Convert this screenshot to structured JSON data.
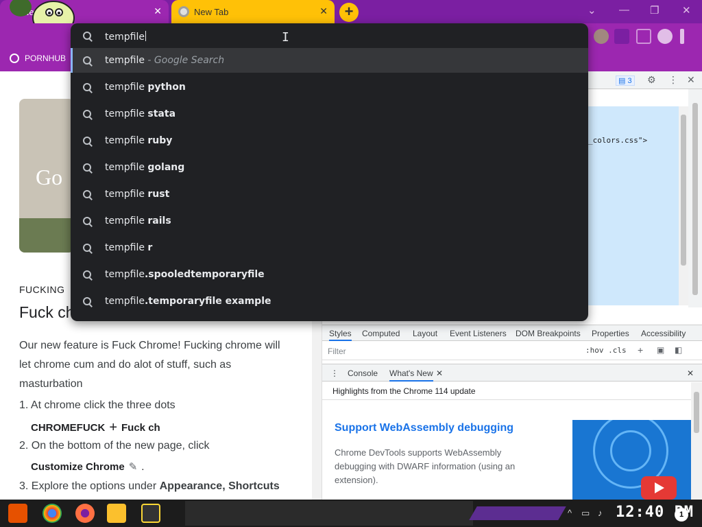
{
  "tabs": [
    {
      "title": "New",
      "close": "✕"
    },
    {
      "title": "New Tab",
      "close": "✕"
    }
  ],
  "new_tab_glyph": "+",
  "window_controls": {
    "minimize": "⌄",
    "restore": "—",
    "maximize": "❐",
    "close": "✕"
  },
  "bookmarks": [
    {
      "label": "PORNHUB",
      "icon": "globe-icon"
    }
  ],
  "omnibox": {
    "value": "tempfile",
    "suggestions": [
      {
        "typed": "tempfile",
        "rest": "",
        "hint": " - Google Search",
        "selected": true
      },
      {
        "typed": "tempfile ",
        "rest": "python",
        "hint": ""
      },
      {
        "typed": "tempfile ",
        "rest": "stata",
        "hint": ""
      },
      {
        "typed": "tempfile ",
        "rest": "ruby",
        "hint": ""
      },
      {
        "typed": "tempfile ",
        "rest": "golang",
        "hint": ""
      },
      {
        "typed": "tempfile ",
        "rest": "rust",
        "hint": ""
      },
      {
        "typed": "tempfile ",
        "rest": "rails",
        "hint": ""
      },
      {
        "typed": "tempfile ",
        "rest": "r",
        "hint": ""
      },
      {
        "typed": "tempfile",
        "rest": ".spooledtemporaryfile",
        "hint": ""
      },
      {
        "typed": "tempfile",
        "rest": ".temporaryfile example",
        "hint": ""
      }
    ]
  },
  "page": {
    "kicker": "FUCKING",
    "title": "Fuck ch",
    "paragraph": "Our new feature is Fuck Chrome! Fucking chrome will let chrome cum and do alot of stuff, such as masturbation",
    "steps": [
      {
        "num": "1.",
        "text": "At chrome click the three dots",
        "sub": "CHROMEFUCK",
        "sub_glyph": "+",
        "sub_tail": "Fuck ch"
      },
      {
        "num": "2.",
        "text": "On the bottom of the new page, click",
        "sub": "Customize Chrome",
        "sub_glyph": "✎",
        "sub_tail": "."
      },
      {
        "num": "3.",
        "text": "Explore the options under ",
        "bold": "Appearance, Shortcuts"
      }
    ],
    "card_text": "Go"
  },
  "devtools": {
    "issues_count": "3",
    "dom_snippet": "_colors.css\">",
    "style_tabs": [
      "Styles",
      "Computed",
      "Layout",
      "Event Listeners",
      "DOM Breakpoints",
      "Properties",
      "Accessibility"
    ],
    "filter_placeholder": "Filter",
    "filter_buttons": ":hov  .cls",
    "drawer_tabs": [
      "Console",
      "What's New"
    ],
    "whats_new_header": "Highlights from the Chrome 114 update",
    "article_title": "Support WebAssembly debugging",
    "article_body": "Chrome DevTools supports WebAssembly debugging with DWARF information (using an extension)."
  },
  "taskbar": {
    "clock": "12:40 PM",
    "notifications": "1"
  },
  "colors": {
    "tab_active": "#9c27b0",
    "tab_inactive": "#ffc107",
    "omnibox_bg": "#202124",
    "devtools_accent": "#1a73e8"
  }
}
